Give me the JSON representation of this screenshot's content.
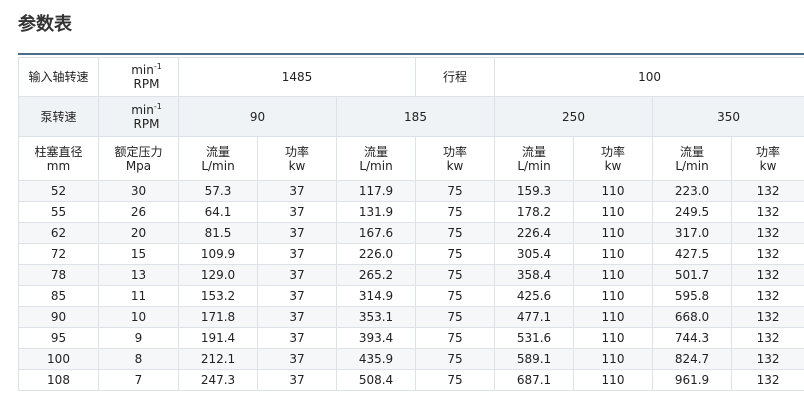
{
  "heading": "参数表",
  "table": {
    "row1": {
      "label": "输入轴转速",
      "unit_main": "min",
      "unit_sup": "-1",
      "unit_rpm": "RPM",
      "speed_value": "1485",
      "stroke_label": "行程",
      "stroke_value": "100"
    },
    "row2": {
      "label": "泵转速",
      "unit_main": "min",
      "unit_sup": "-1",
      "unit_rpm": "RPM",
      "speeds": [
        "90",
        "185",
        "250",
        "350"
      ]
    },
    "row3": {
      "plunger_label": "柱塞直径",
      "plunger_unit": "mm",
      "pressure_label": "额定压力",
      "pressure_unit": "Mpa",
      "flow_label": "流量",
      "flow_unit": "L/min",
      "power_label": "功率",
      "power_unit": "kw"
    },
    "rows": [
      [
        "52",
        "30",
        "57.3",
        "37",
        "117.9",
        "75",
        "159.3",
        "110",
        "223.0",
        "132"
      ],
      [
        "55",
        "26",
        "64.1",
        "37",
        "131.9",
        "75",
        "178.2",
        "110",
        "249.5",
        "132"
      ],
      [
        "62",
        "20",
        "81.5",
        "37",
        "167.6",
        "75",
        "226.4",
        "110",
        "317.0",
        "132"
      ],
      [
        "72",
        "15",
        "109.9",
        "37",
        "226.0",
        "75",
        "305.4",
        "110",
        "427.5",
        "132"
      ],
      [
        "78",
        "13",
        "129.0",
        "37",
        "265.2",
        "75",
        "358.4",
        "110",
        "501.7",
        "132"
      ],
      [
        "85",
        "11",
        "153.2",
        "37",
        "314.9",
        "75",
        "425.6",
        "110",
        "595.8",
        "132"
      ],
      [
        "90",
        "10",
        "171.8",
        "37",
        "353.1",
        "75",
        "477.1",
        "110",
        "668.0",
        "132"
      ],
      [
        "95",
        "9",
        "191.4",
        "37",
        "393.4",
        "75",
        "531.6",
        "110",
        "744.3",
        "132"
      ],
      [
        "100",
        "8",
        "212.1",
        "37",
        "435.9",
        "75",
        "589.1",
        "110",
        "824.7",
        "132"
      ],
      [
        "108",
        "7",
        "247.3",
        "37",
        "508.4",
        "75",
        "687.1",
        "110",
        "961.9",
        "132"
      ]
    ]
  }
}
